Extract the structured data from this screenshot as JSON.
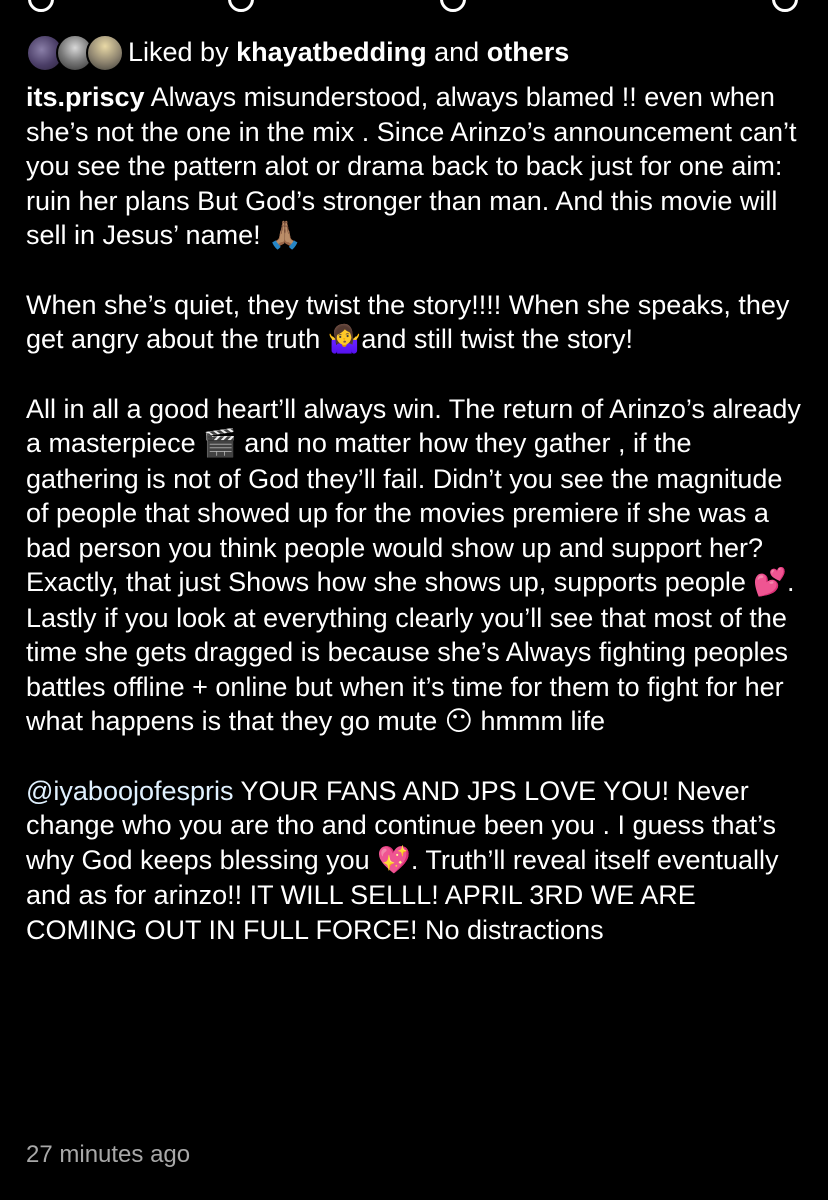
{
  "likes": {
    "prefix": "Liked by",
    "user": "khayatbedding",
    "and": "and",
    "others": "others"
  },
  "caption": {
    "username": "its.priscy",
    "p1": "Always misunderstood, always blamed !! even when she’s not the one in the mix . Since Arinzo’s announcement can’t you see the pattern alot or drama back to back just for one aim: ruin her plans  But God’s stronger than man. And this movie will sell in Jesus’ name!",
    "p1_emoji": "🙏🏽",
    "p2_a": "When she’s quiet, they twist the story!!!! When she speaks, they get angry about the truth",
    "p2_emoji": "🤷‍♀️",
    "p2_b": "and still twist the story!",
    "p3_a": "All in all a good heart’ll always win. The return of Arinzo’s already a masterpiece",
    "p3_emoji1": "🎬",
    "p3_b": "and no matter how they gather , if the gathering is not of God they’ll fail. Didn’t you see the magnitude of people that showed up for the movies premiere if she was a bad person you think people would show up and support her?  Exactly, that just Shows how she shows up, supports people",
    "p3_emoji2": "💕",
    "p3_c": ". Lastly if you look at everything clearly you’ll see that most of the time she gets dragged is because she’s Always fighting peoples battles offline + online but when it’s time for them to fight for her what happens is that they go mute",
    "p3_emoji3": "😶",
    "p3_d": "hmmm life",
    "p4_mention": "@iyaboojofespris",
    "p4_a": "YOUR FANS AND JPS LOVE YOU! Never change who you are tho and continue been you . I guess that’s why God keeps blessing you",
    "p4_emoji": "💖",
    "p4_b": ". Truth’ll reveal itself eventually and as for arinzo!! IT WILL SELLL! APRIL 3RD WE ARE COMING OUT IN FULL FORCE! No distractions"
  },
  "timestamp": "27 minutes ago",
  "colors": {
    "background": "#000000",
    "text": "#ffffff",
    "mention": "#e0f1ff",
    "timestamp": "#a8a8a8"
  }
}
